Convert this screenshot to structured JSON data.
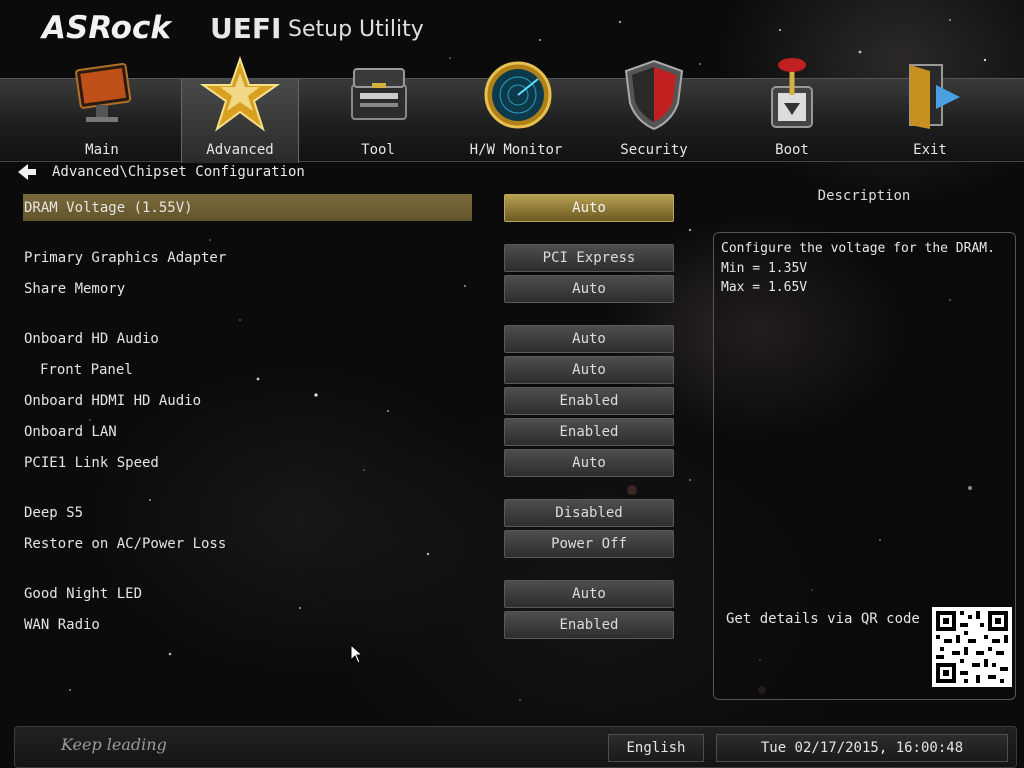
{
  "header": {
    "brand": "ASRock",
    "product": "UEFI",
    "subtitle": "Setup Utility"
  },
  "tabs": [
    {
      "label": "Main",
      "icon": "monitor-icon",
      "active": false
    },
    {
      "label": "Advanced",
      "icon": "star-icon",
      "active": true
    },
    {
      "label": "Tool",
      "icon": "toolbox-icon",
      "active": false
    },
    {
      "label": "H/W Monitor",
      "icon": "radar-icon",
      "active": false
    },
    {
      "label": "Security",
      "icon": "shield-icon",
      "active": false
    },
    {
      "label": "Boot",
      "icon": "boot-lever-icon",
      "active": false
    },
    {
      "label": "Exit",
      "icon": "exit-door-icon",
      "active": false
    }
  ],
  "breadcrumb": "Advanced\\Chipset Configuration",
  "settings": [
    {
      "label": "DRAM Voltage (1.55V)",
      "value": "Auto",
      "selected": true
    },
    {
      "label": "Primary Graphics Adapter",
      "value": "PCI Express"
    },
    {
      "label": "Share Memory",
      "value": "Auto"
    },
    {
      "label": "Onboard HD Audio",
      "value": "Auto"
    },
    {
      "label": "Front Panel",
      "value": "Auto",
      "indent": true
    },
    {
      "label": "Onboard HDMI HD Audio",
      "value": "Enabled"
    },
    {
      "label": "Onboard LAN",
      "value": "Enabled"
    },
    {
      "label": "PCIE1 Link Speed",
      "value": "Auto"
    },
    {
      "label": "Deep S5",
      "value": "Disabled"
    },
    {
      "label": "Restore on AC/Power Loss",
      "value": "Power Off"
    },
    {
      "label": "Good Night LED",
      "value": "Auto"
    },
    {
      "label": "WAN Radio",
      "value": "Enabled"
    }
  ],
  "description": {
    "title": "Description",
    "lines": [
      "Configure the voltage for the DRAM.",
      "Min = 1.35V",
      "Max = 1.65V"
    ],
    "qr_label": "Get details via QR code"
  },
  "footer": {
    "tagline": "Keep leading",
    "language": "English",
    "datetime": "Tue 02/17/2015, 16:00:48"
  },
  "colors": {
    "selected_row": "#6e5f33",
    "value_button": "#3a3a38",
    "background": "#0b0b0c"
  }
}
